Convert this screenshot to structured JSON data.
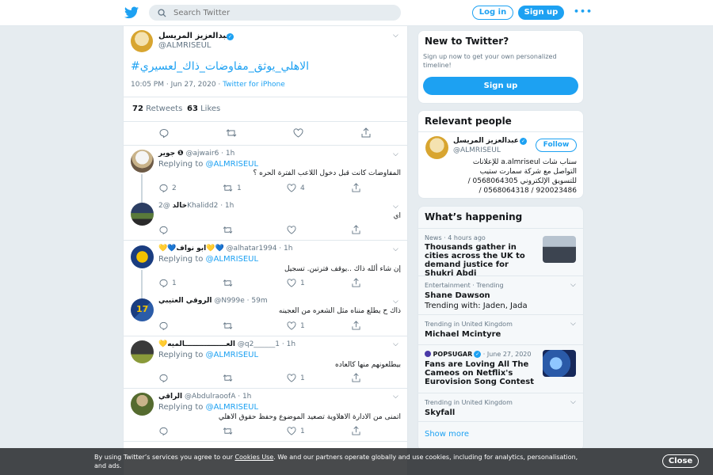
{
  "search": {
    "placeholder": "Search Twitter"
  },
  "header": {
    "login": "Log in",
    "signup": "Sign up",
    "more": "•••"
  },
  "main_tweet": {
    "name": "عبدالعزيز المريسل",
    "handle": "@ALMRISEUL",
    "text": "#الاهلي_يوثق_مفاوضات_ذاك_لعسيري",
    "time": "10:05 PM · Jun 27, 2020 · ",
    "source": "Twitter for iPhone",
    "retweets_count": "72",
    "retweets_label": "Retweets",
    "likes_count": "63",
    "likes_label": "Likes"
  },
  "replies": [
    {
      "name": "جوير",
      "handle": "@ajwair6 · 1h",
      "replying": "Replying to",
      "to": "@ALMRISEUL",
      "text": "المفاوضات كانت قبل دخول اللاعب الفترة الحره ؟",
      "reply_count": "2",
      "rt_count": "1",
      "like_count": "4"
    },
    {
      "name": "خالد",
      "handle": "@2Khalidd2 · 1h",
      "text": "اي",
      "reply_count": "",
      "rt_count": "",
      "like_count": ""
    },
    {
      "name": "💛💙ابو نواف💛💙",
      "handle": "@alhatar1994 · 1h",
      "replying": "Replying to",
      "to": "@ALMRISEUL",
      "text": "إن شاء ألله ذاك ..يوقف فترتين. تسجيل",
      "reply_count": "1",
      "rt_count": "",
      "like_count": "1"
    },
    {
      "name": "الروقي العتيبي",
      "handle": "@N999e · 59m",
      "text": "ذاك ح يطلع منناه مثل الشعره من العجينه",
      "reply_count": "",
      "rt_count": "",
      "like_count": "1"
    },
    {
      "name": "💛العـــــــــــــــــالميه",
      "handle": "@q2______1 · 1h",
      "replying": "Replying to",
      "to": "@ALMRISEUL",
      "text": "بيطلعونهم منها  كالعاده",
      "reply_count": "",
      "rt_count": "",
      "like_count": "1"
    },
    {
      "name": "الراقي",
      "handle": "@AbdulraoofA · 1h",
      "replying": "Replying to",
      "to": "@ALMRISEUL",
      "text": "اتمنى من الادارة الاهلاوية تصعيد الموضوع وحفظ حقوق الاهلي",
      "reply_count": "",
      "rt_count": "",
      "like_count": "1"
    }
  ],
  "new_to_twitter": {
    "title": "New to Twitter?",
    "desc": "Sign up now to get your own personalized timeline!",
    "button": "Sign up"
  },
  "relevant": {
    "title": "Relevant people",
    "name": "عبدالعزيز المريسل",
    "handle": "@ALMRISEUL",
    "follow": "Follow",
    "bio_1": "سناب شات a.almriseul للإعلانات",
    "bio_2": "التواصل مع شركة سمارت ستيب",
    "bio_3": "للتسويق الإلكتروني 0568064305 /",
    "bio_4": "920023486 / 0568064318 /"
  },
  "happening": {
    "title": "What’s happening",
    "items": [
      {
        "meta": "News · 4 hours ago",
        "title": "Thousands gather in cities across the UK to demand justice for Shukri Abdi",
        "sub": ""
      },
      {
        "meta": "Entertainment · Trending",
        "title": "Shane Dawson",
        "sub": "Trending with: Jaden, Jada"
      },
      {
        "meta": "Trending in United Kingdom",
        "title": "Michael Mcintyre",
        "sub": ""
      },
      {
        "meta_source": "POPSUGAR",
        "meta": " · June 27, 2020",
        "title": "Fans are Loving All The Cameos on Netflix's Eurovision Song Contest",
        "sub": ""
      },
      {
        "meta": "Trending in United Kingdom",
        "title": "Skyfall",
        "sub": ""
      }
    ],
    "show_more": "Show more"
  },
  "cookie": {
    "pre": "By using Twitter’s services you agree to our ",
    "link": "Cookies Use",
    "post": ". We and our partners operate globally and use cookies, including for analytics, personalisation, and ads.",
    "close": "Close"
  },
  "colors": {
    "accent": "#1da1f2",
    "background": "#e6ecf0",
    "text": "#14171a",
    "secondary": "#657786"
  }
}
